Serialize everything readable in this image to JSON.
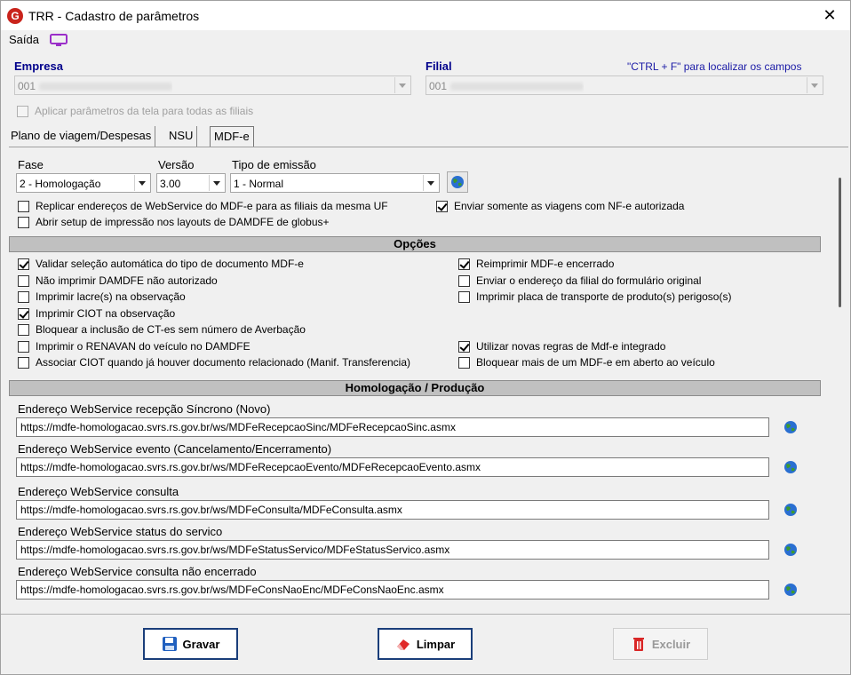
{
  "window": {
    "title": "TRR - Cadastro de parâmetros",
    "close_glyph": "✕",
    "app_glyph": "G"
  },
  "menu": {
    "saida": "Saída"
  },
  "header": {
    "empresa_label": "Empresa",
    "empresa_value": "001",
    "filial_label": "Filial",
    "filial_value": "001",
    "hint": "\"CTRL + F\" para localizar os campos",
    "apply_all": "Aplicar parâmetros da tela para todas as filiais"
  },
  "tabs": [
    "Plano de viagem/Despesas",
    "NSU",
    "MDF-e"
  ],
  "mdfe": {
    "fase_label": "Fase",
    "fase_value": "2 - Homologação",
    "versao_label": "Versão",
    "versao_value": "3.00",
    "tipo_label": "Tipo de emissão",
    "tipo_value": "1 - Normal",
    "replicar": "Replicar endereços de WebService do MDF-e para as filiais da mesma UF",
    "enviar_somente": "Enviar somente as viagens com NF-e autorizada",
    "abrir_setup": "Abrir setup de impressão nos layouts de DAMDFE de globus+"
  },
  "opcoes": {
    "title": "Opções",
    "left": [
      {
        "label": "Validar seleção automática do tipo de documento MDF-e",
        "checked": true
      },
      {
        "label": "Não imprimir DAMDFE não autorizado",
        "checked": false
      },
      {
        "label": "Imprimir lacre(s) na observação",
        "checked": false
      },
      {
        "label": "Imprimir CIOT na observação",
        "checked": true
      },
      {
        "label": "Bloquear a inclusão de CT-es sem número de Averbação",
        "checked": false
      },
      {
        "label": "Imprimir o RENAVAN do veículo no DAMDFE",
        "checked": false
      },
      {
        "label": "Associar CIOT quando já houver documento relacionado (Manif. Transferencia)",
        "checked": false
      }
    ],
    "right": [
      {
        "label": "Reimprimir MDF-e encerrado",
        "checked": true,
        "row": 0
      },
      {
        "label": "Enviar o endereço da filial do formulário original",
        "checked": false,
        "row": 1
      },
      {
        "label": "Imprimir placa de transporte de produto(s) perigoso(s)",
        "checked": false,
        "row": 2
      },
      {
        "label": "Utilizar novas regras de Mdf-e integrado",
        "checked": true,
        "row": 5
      },
      {
        "label": "Bloquear mais de um MDF-e em aberto ao veículo",
        "checked": false,
        "row": 6
      }
    ]
  },
  "homolog": {
    "title": "Homologação / Produção",
    "fields": [
      {
        "label": "Endereço WebService recepção Síncrono (Novo)",
        "value": "https://mdfe-homologacao.svrs.rs.gov.br/ws/MDFeRecepcaoSinc/MDFeRecepcaoSinc.asmx"
      },
      {
        "label": "Endereço WebService evento (Cancelamento/Encerramento)",
        "value": "https://mdfe-homologacao.svrs.rs.gov.br/ws/MDFeRecepcaoEvento/MDFeRecepcaoEvento.asmx"
      },
      {
        "label": "Endereço WebService consulta",
        "value": "https://mdfe-homologacao.svrs.rs.gov.br/ws/MDFeConsulta/MDFeConsulta.asmx"
      },
      {
        "label": "Endereço WebService status do servico",
        "value": "https://mdfe-homologacao.svrs.rs.gov.br/ws/MDFeStatusServico/MDFeStatusServico.asmx"
      },
      {
        "label": "Endereço WebService consulta não encerrado",
        "value": "https://mdfe-homologacao.svrs.rs.gov.br/ws/MDFeConsNaoEnc/MDFeConsNaoEnc.asmx"
      }
    ]
  },
  "buttons": {
    "gravar": "Gravar",
    "limpar": "Limpar",
    "excluir": "Excluir"
  },
  "icons": {
    "globe": "globe-icon",
    "save": "floppy-icon",
    "clear": "eraser-icon",
    "delete": "trash-icon",
    "monitor": "monitor-icon"
  },
  "colors": {
    "label_blue": "#00008b",
    "button_border": "#1a3e7a",
    "section_gray": "#c0c0c0",
    "monitor_purple": "#9b2fc9"
  }
}
